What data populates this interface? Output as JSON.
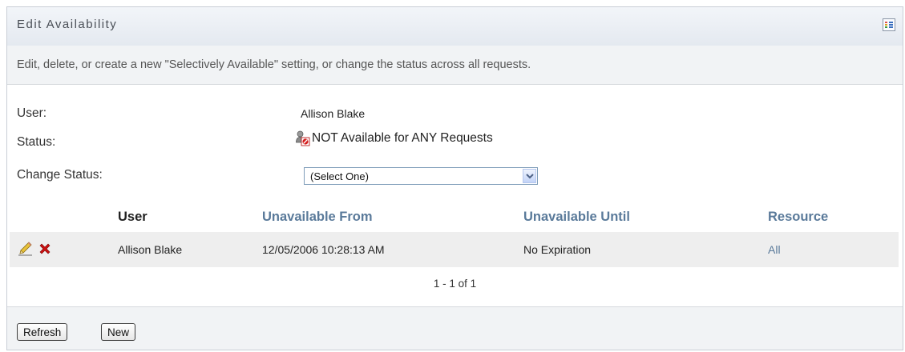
{
  "panel": {
    "title": "Edit Availability",
    "layout_icon": "grid-layout-icon",
    "description": "Edit, delete, or create a new \"Selectively Available\" setting, or change the status across all requests."
  },
  "form": {
    "user_label": "User:",
    "user_value": "Allison Blake",
    "status_label": "Status:",
    "status_icon": "not-available-user-icon",
    "status_value": "NOT Available for ANY Requests",
    "change_status_label": "Change Status:",
    "change_status_selected": "(Select One)"
  },
  "table": {
    "columns": {
      "user": "User",
      "unavailable_from": "Unavailable From",
      "unavailable_until": "Unavailable Until",
      "resource": "Resource"
    },
    "rows": [
      {
        "user": "Allison Blake",
        "unavailable_from": "12/05/2006 10:28:13 AM",
        "unavailable_until": "No Expiration",
        "resource": "All"
      }
    ],
    "pagination": "1 - 1 of 1"
  },
  "buttons": {
    "refresh": "Refresh",
    "new": "New"
  },
  "colors": {
    "link": "#5a7a9a",
    "delete_icon": "#cc1111",
    "panel_header_bg": "#e4e9f0",
    "row_bg": "#eeeeee"
  }
}
